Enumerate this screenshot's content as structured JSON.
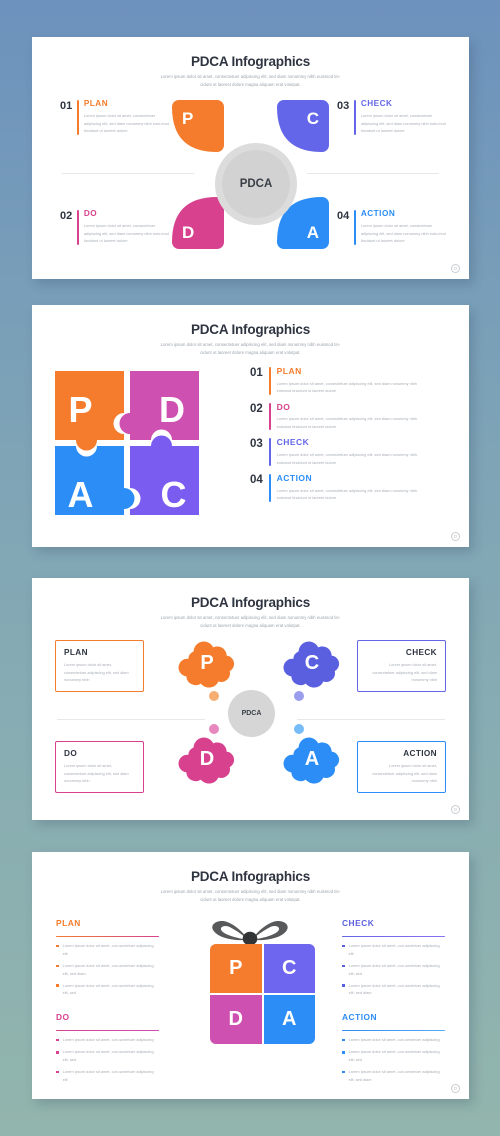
{
  "background": {
    "top_color": "#6d92bd",
    "bottom_color": "#92b5ad"
  },
  "colors": {
    "plan": "#F47C2C",
    "do": "#D7418E",
    "check": "#6366E8",
    "action": "#2B8DF5",
    "purple_puzzle": "#7B5CF0",
    "magenta_puzzle": "#CE50B0",
    "center_gray": "#d6d6d6",
    "heading_dark": "#2e3440",
    "body_gray": "#a8aeb6"
  },
  "common": {
    "title": "PDCA Infographics",
    "subtitle_line1": "Lorem ipsum dolor sit amet, consectetuer adipiscing elit, sed diam nonummy nibh euismod tin-",
    "subtitle_line2": "cidunt ut laoreet dolore magna aliquam erat volutpat.",
    "center_label": "PDCA",
    "watermark": "D"
  },
  "slide1": {
    "letters": {
      "p": "P",
      "c": "C",
      "d": "D",
      "a": "A"
    },
    "items": [
      {
        "num": "01",
        "label": "PLAN",
        "color": "#F47C2C",
        "desc": "Lorem ipsum dolor sit amet, consectetuer adipiscing elit, sed diam nonummy nibh euis-mod tincidunt ut laoreet dolore"
      },
      {
        "num": "02",
        "label": "DO",
        "color": "#D7418E",
        "desc": "Lorem ipsum dolor sit amet, consectetuer adipiscing elit, sed diam nonummy nibh euis-mod tincidunt ut laoreet dolore"
      },
      {
        "num": "03",
        "label": "CHECK",
        "color": "#6366E8",
        "desc": "Lorem ipsum dolor sit amet, consectetuer adipiscing elit, sed diam nonummy nibh euis-mod tincidunt ut laoreet dolore"
      },
      {
        "num": "04",
        "label": "ACTION",
        "color": "#2B8DF5",
        "desc": "Lorem ipsum dolor sit amet, consectetuer adipiscing elit, sed diam nonummy nibh euis-mod tincidunt ut laoreet dolore"
      }
    ]
  },
  "slide2": {
    "puzzle": [
      {
        "letter": "P",
        "color": "#F47C2C",
        "position": "top-left"
      },
      {
        "letter": "D",
        "color": "#CE50B0",
        "position": "top-right"
      },
      {
        "letter": "A",
        "color": "#2B8DF5",
        "position": "bottom-left"
      },
      {
        "letter": "C",
        "color": "#7B5CF0",
        "position": "bottom-right"
      }
    ],
    "items": [
      {
        "num": "01",
        "label": "PLAN",
        "color": "#F47C2C",
        "desc": "Lorem ipsum dolor sit amet, consectetuer adipiscing elit, sed diam nonummy nibh euismod tincidunt ut laoreet dolore"
      },
      {
        "num": "02",
        "label": "DO",
        "color": "#D7418E",
        "desc": "Lorem ipsum dolor sit amet, consectetuer adipiscing elit, sed diam nonummy nibh euismod tincidunt ut laoreet dolore"
      },
      {
        "num": "03",
        "label": "CHECK",
        "color": "#6366E8",
        "desc": "Lorem ipsum dolor sit amet, consectetuer adipiscing elit, sed diam nonummy nibh euismod tincidunt ut laoreet dolore"
      },
      {
        "num": "04",
        "label": "ACTION",
        "color": "#2B8DF5",
        "desc": "Lorem ipsum dolor sit amet, consectetuer adipiscing elit, sed diam nonummy nibh euismod tincidunt ut laoreet dolore"
      }
    ]
  },
  "slide3": {
    "boxes": [
      {
        "label": "PLAN",
        "color": "#F47C2C",
        "desc": "Lorem ipsum dolor sit amet, consectetuer adipiscing elit, sed diam nonummy nibh"
      },
      {
        "label": "CHECK",
        "color": "#6366E8",
        "desc": "Lorem ipsum dolor sit amet, consectetuer adipiscing elit, sed diam nonummy nibh"
      },
      {
        "label": "DO",
        "color": "#D7418E",
        "desc": "Lorem ipsum dolor sit amet, consectetuer adipiscing elit, sed diam nonummy nibh"
      },
      {
        "label": "ACTION",
        "color": "#2B8DF5",
        "desc": "Lorem ipsum dolor sit amet, consectetuer adipiscing elit, sed diam nonummy nibh"
      }
    ],
    "clouds": [
      {
        "letter": "P",
        "color": "#F47C2C"
      },
      {
        "letter": "C",
        "color": "#5A5FE0"
      },
      {
        "letter": "D",
        "color": "#D7418E"
      },
      {
        "letter": "A",
        "color": "#2B8DF5"
      }
    ]
  },
  "slide4": {
    "grid": [
      {
        "letter": "P",
        "color": "#F47C2C"
      },
      {
        "letter": "C",
        "color": "#6E66EE"
      },
      {
        "letter": "D",
        "color": "#CE50B0"
      },
      {
        "letter": "A",
        "color": "#2B8DF5"
      }
    ],
    "columns": [
      {
        "label": "PLAN",
        "color": "#F47C2C",
        "rule_from": "#F47C2C",
        "rule_to": "#D7418E",
        "bullets": [
          "Lorem ipsum dolor sit amet, con-sectetuer adipiscing elit",
          "Lorem ipsum dolor sit amet, con-sectetuer adipiscing elit, sed diam.",
          "Lorem ipsum dolor sit amet, con-sectetuer adipiscing elit, sed"
        ]
      },
      {
        "label": "DO",
        "color": "#D7418E",
        "rule_from": "#D7418E",
        "rule_to": "#CE50B0",
        "bullets": [
          "Lorem ipsum dolor sit amet, con-sectetuer adipiscing",
          "Lorem ipsum dolor sit amet, con-sectetuer adipiscing elit, sed",
          "Lorem ipsum dolor sit amet, con-sectetuer adipiscing elit"
        ]
      },
      {
        "label": "CHECK",
        "color": "#5A5FE0",
        "rule_from": "#6366E8",
        "rule_to": "#8B6FF0",
        "bullets": [
          "Lorem ipsum dolor sit amet, con-sectetuer adipiscing elit",
          "Lorem ipsum dolor sit amet, con-sectetuer adipiscing elit, sed",
          "Lorem ipsum dolor sit amet, con-sectetuer adipiscing elit, sed diam"
        ]
      },
      {
        "label": "ACTION",
        "color": "#2B8DF5",
        "rule_from": "#2B8DF5",
        "rule_to": "#5AA8F8",
        "bullets": [
          "Lorem ipsum dolor sit amet, con-sectetuer adipiscing",
          "Lorem ipsum dolor sit amet, con-sectetuer adipiscing elit, sed",
          "Lorem ipsum dolor sit amet, con-sectetuer adipiscing elit, sed diam"
        ]
      }
    ],
    "bow_color": "#58595B"
  }
}
